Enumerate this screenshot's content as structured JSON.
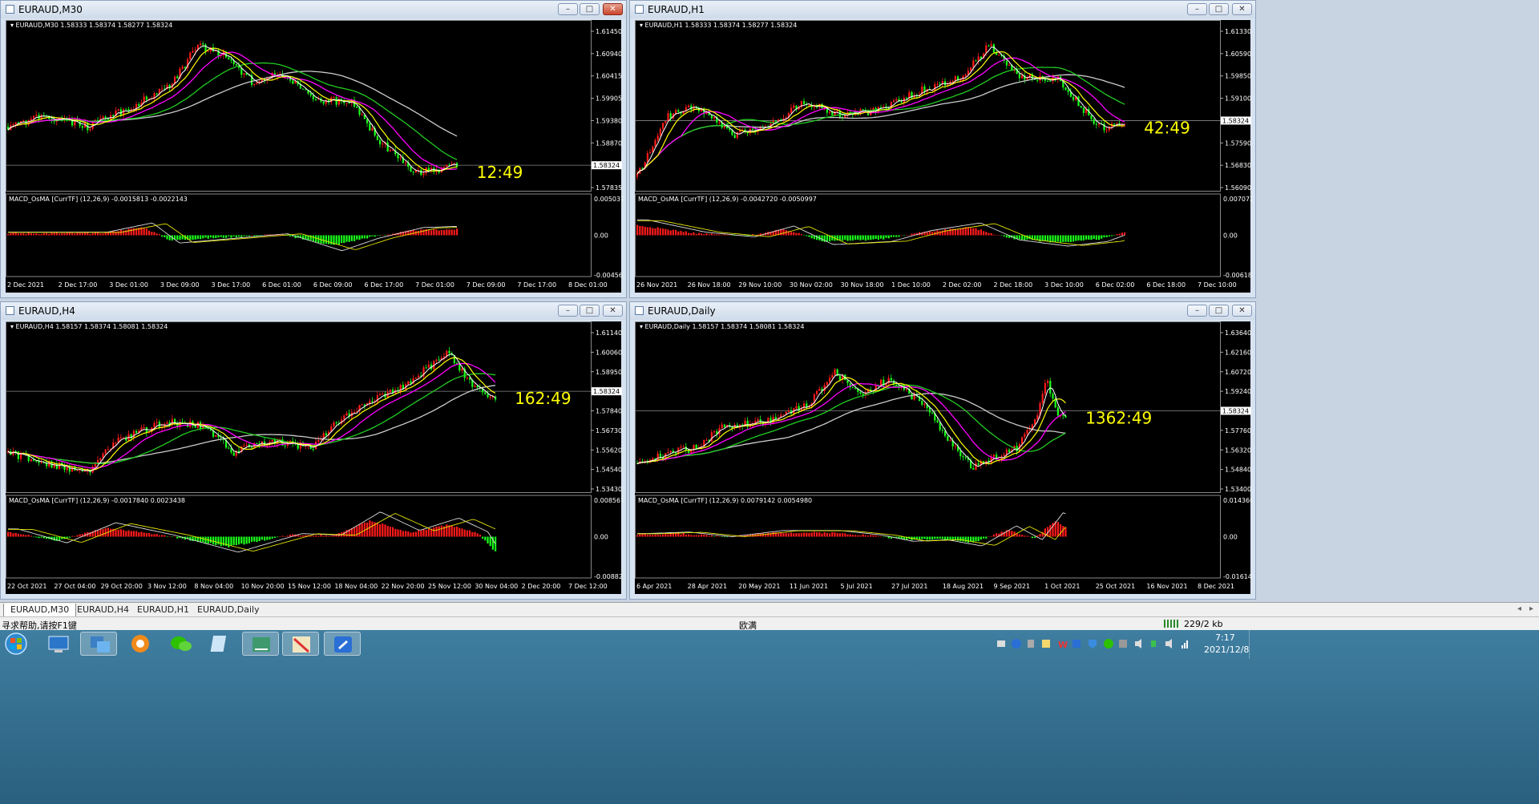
{
  "windows": [
    {
      "id": "m30",
      "title": "EURAUD,M30",
      "header": "EURAUD,M30  1.58333 1.58374 1.58277 1.58324",
      "macd_label": "MACD_OsMA [CurrTF] (12,26,9) -0.0015813 -0.0022143",
      "countdown": "12:49",
      "price_ticks": [
        "1.61450",
        "1.60940",
        "1.60415",
        "1.59905",
        "1.59380",
        "1.58870",
        "1.58324",
        "1.57835"
      ],
      "macd_ticks": [
        "0.0050376",
        "0.00",
        "-0.0045626"
      ],
      "time_ticks": [
        "2 Dec 2021",
        "2 Dec 17:00",
        "3 Dec 01:00",
        "3 Dec 09:00",
        "3 Dec 17:00",
        "6 Dec 01:00",
        "6 Dec 09:00",
        "6 Dec 17:00",
        "7 Dec 01:00",
        "7 Dec 09:00",
        "7 Dec 17:00",
        "8 Dec 01:00"
      ]
    },
    {
      "id": "h1",
      "title": "EURAUD,H1",
      "header": "EURAUD,H1  1.58333 1.58374 1.58277 1.58324",
      "macd_label": "MACD_OsMA [CurrTF] (12,26,9) -0.0042720 -0.0050997",
      "countdown": "42:49",
      "price_ticks": [
        "1.61330",
        "1.60590",
        "1.59850",
        "1.59100",
        "1.58324",
        "1.57590",
        "1.56830",
        "1.56090"
      ],
      "macd_ticks": [
        "0.0070727",
        "0.00",
        "-0.0061844"
      ],
      "time_ticks": [
        "26 Nov 2021",
        "26 Nov 18:00",
        "29 Nov 10:00",
        "30 Nov 02:00",
        "30 Nov 18:00",
        "1 Dec 10:00",
        "2 Dec 02:00",
        "2 Dec 18:00",
        "3 Dec 10:00",
        "6 Dec 02:00",
        "6 Dec 18:00",
        "7 Dec 10:00"
      ]
    },
    {
      "id": "h4",
      "title": "EURAUD,H4",
      "header": "EURAUD,H4  1.58157 1.58374 1.58081 1.58324",
      "macd_label": "MACD_OsMA [CurrTF] (12,26,9) -0.0017840 0.0023438",
      "countdown": "162:49",
      "price_ticks": [
        "1.61140",
        "1.60060",
        "1.58950",
        "1.58324",
        "1.57840",
        "1.56730",
        "1.55620",
        "1.54540",
        "1.53430"
      ],
      "macd_ticks": [
        "0.0085675",
        "0.00",
        "-0.0088294"
      ],
      "time_ticks": [
        "22 Oct 2021",
        "27 Oct 04:00",
        "29 Oct 20:00",
        "3 Nov 12:00",
        "8 Nov 04:00",
        "10 Nov 20:00",
        "15 Nov 12:00",
        "18 Nov 04:00",
        "22 Nov 20:00",
        "25 Nov 12:00",
        "30 Nov 04:00",
        "2 Dec 20:00",
        "7 Dec 12:00"
      ]
    },
    {
      "id": "d1",
      "title": "EURAUD,Daily",
      "header": "EURAUD,Daily  1.58157 1.58374 1.58081 1.58324",
      "macd_label": "MACD_OsMA [CurrTF] (12,26,9) 0.0079142 0.0054980",
      "countdown": "1362:49",
      "price_ticks": [
        "1.63640",
        "1.62160",
        "1.60720",
        "1.59240",
        "1.58324",
        "1.57760",
        "1.56320",
        "1.54840",
        "1.53400"
      ],
      "macd_ticks": [
        "0.0143607",
        "0.00",
        "-0.0161449"
      ],
      "time_ticks": [
        "6 Apr 2021",
        "28 Apr 2021",
        "20 May 2021",
        "11 Jun 2021",
        "5 Jul 2021",
        "27 Jul 2021",
        "18 Aug 2021",
        "9 Sep 2021",
        "1 Oct 2021",
        "25 Oct 2021",
        "16 Nov 2021",
        "8 Dec 2021"
      ]
    }
  ],
  "tabs": [
    "EURAUD,M30",
    "EURAUD,H4",
    "EURAUD,H1",
    "EURAUD,Daily"
  ],
  "status": {
    "help": "寻求帮助,请按F1键",
    "profile": "欧满",
    "traffic": "229/2 kb"
  },
  "clock": {
    "time": "7:17",
    "date": "2021/12/8"
  },
  "colors": {
    "bull": "#ff1a1a",
    "bear": "#1aff1a",
    "ma_fast": "#ffffff",
    "ma_yellow": "#ffff00",
    "ma_magenta": "#ff00ff",
    "ma_green": "#22cc22",
    "ma_grey": "#cccccc",
    "countdown": "#ffff00"
  },
  "taskbar_icons": [
    "start-orb-icon",
    "show-desktop-icon",
    "network-icon",
    "browser-icon",
    "wechat-icon",
    "notepad-icon",
    "app-icon",
    "metatrader-icon",
    "messenger-icon"
  ]
}
